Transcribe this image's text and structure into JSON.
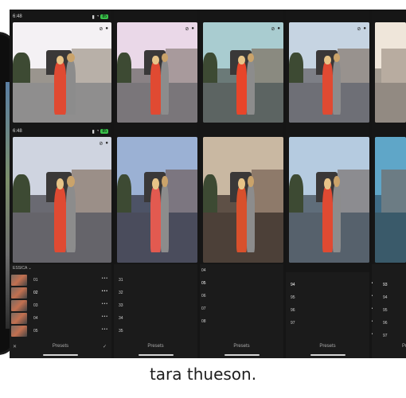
{
  "status": {
    "time": "6:48",
    "battery": "85"
  },
  "panel": {
    "group": "ESSICA",
    "presets_label": "Presets"
  },
  "screens": [
    {
      "rows": [
        {
          "num": "01",
          "menu": "•••"
        },
        {
          "num": "02",
          "menu": "•••"
        },
        {
          "num": "03",
          "menu": "•••"
        },
        {
          "num": "04",
          "menu": "•••"
        },
        {
          "num": "05",
          "menu": "•••"
        }
      ]
    },
    {
      "rows": [
        {
          "num": "31",
          "menu": "•••"
        },
        {
          "num": "32",
          "menu": "•••"
        },
        {
          "num": "33",
          "menu": "•••"
        },
        {
          "num": "34",
          "menu": "•••"
        },
        {
          "num": "35",
          "menu": "•••"
        }
      ]
    },
    {
      "rows": [
        {
          "num": "04",
          "menu": "•••"
        },
        {
          "num": "05",
          "menu": "•••"
        },
        {
          "num": "06",
          "menu": "•••"
        },
        {
          "num": "07",
          "menu": "•••"
        },
        {
          "num": "08",
          "menu": "•••"
        }
      ]
    },
    {
      "rows": [
        {
          "num": "94",
          "menu": "•••"
        },
        {
          "num": "95",
          "menu": "•••"
        },
        {
          "num": "96",
          "menu": "•••"
        },
        {
          "num": "97",
          "menu": "•••"
        }
      ]
    },
    {
      "rows": [
        {
          "num": "93",
          "menu": "•••"
        },
        {
          "num": "94",
          "menu": "•••"
        },
        {
          "num": "95",
          "menu": "•••"
        },
        {
          "num": "96",
          "menu": "•••"
        },
        {
          "num": "97",
          "menu": "•••"
        }
      ]
    }
  ],
  "footer": {
    "close_icon": "close-icon",
    "check_icon": "check-icon",
    "check": "✓",
    "close": "✕"
  },
  "caption": "tara thueson."
}
